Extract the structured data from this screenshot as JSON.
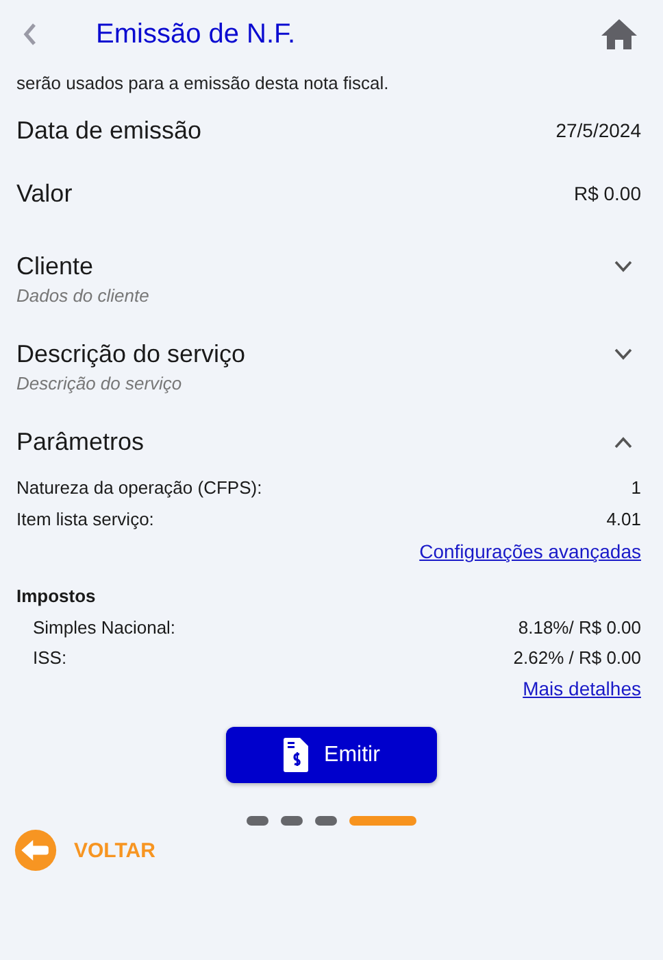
{
  "header": {
    "title": "Emissão de N.F."
  },
  "intro": "serão usados para a emissão desta nota fiscal.",
  "fields": [
    {
      "label": "Data de emissão",
      "value": "27/5/2024"
    },
    {
      "label": "Valor",
      "value": "R$ 0.00"
    }
  ],
  "sections": [
    {
      "title": "Cliente",
      "expanded": false,
      "subtitle": "Dados do cliente"
    },
    {
      "title": "Descrição do serviço",
      "expanded": false,
      "subtitle": "Descrição do serviço"
    },
    {
      "title": "Parâmetros",
      "expanded": true
    }
  ],
  "parameters": [
    {
      "label": "Natureza da operação (CFPS):",
      "value": "1"
    },
    {
      "label": "Item lista serviço:",
      "value": "4.01"
    }
  ],
  "advanced_link": "Configurações avançadas",
  "taxes": {
    "title": "Impostos",
    "rows": [
      {
        "label": "Simples Nacional:",
        "value": "8.18%/ R$ 0.00"
      },
      {
        "label": "ISS:",
        "value": "2.62% / R$ 0.00"
      }
    ],
    "link": "Mais detalhes"
  },
  "emit_button": "Emitir",
  "steps": [
    {
      "selected": false
    },
    {
      "selected": false
    },
    {
      "selected": false
    },
    {
      "selected": true
    }
  ],
  "back": "VOLTAR"
}
